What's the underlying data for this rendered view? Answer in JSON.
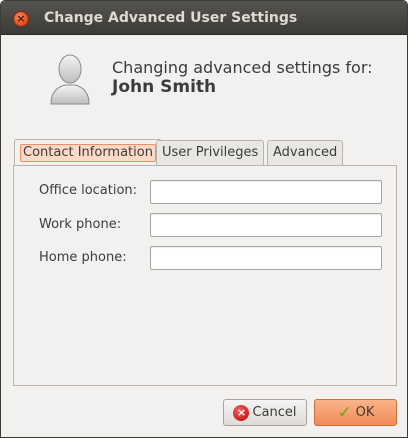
{
  "window": {
    "title": "Change Advanced User Settings"
  },
  "header": {
    "heading": "Changing advanced settings for:",
    "user_name": "John Smith",
    "avatar_icon": "user-avatar-icon"
  },
  "tabs": [
    {
      "label": "Contact Information",
      "selected": true
    },
    {
      "label": "User Privileges",
      "selected": false
    },
    {
      "label": "Advanced",
      "selected": false
    }
  ],
  "contact_form": {
    "office_location": {
      "label": "Office location:",
      "value": ""
    },
    "work_phone": {
      "label": "Work phone:",
      "value": ""
    },
    "home_phone": {
      "label": "Home phone:",
      "value": ""
    }
  },
  "buttons": {
    "cancel_label": "Cancel",
    "ok_label": "OK"
  },
  "colors": {
    "titlebar": "#3c3b37",
    "accent": "#f08a56",
    "window_bg": "#f2f1f0"
  }
}
